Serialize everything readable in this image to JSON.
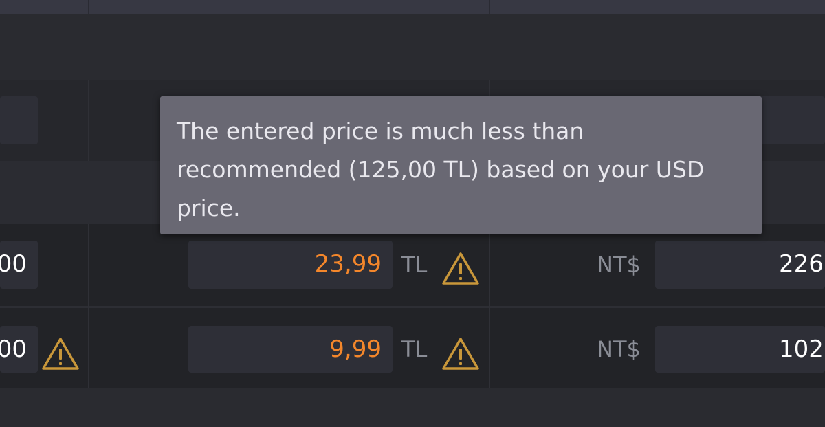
{
  "tooltip": {
    "text": "The entered price is much less than recommended (125,00 TL) based on your USD price."
  },
  "rows": [
    {
      "left_value_partial": "00",
      "tl_price": "23,99",
      "tl_currency": "TL",
      "twd_currency": "NT$",
      "twd_value_partial": "226"
    },
    {
      "left_value_partial": "00",
      "tl_price": "9,99",
      "tl_currency": "TL",
      "twd_currency": "NT$",
      "twd_value_partial": "102"
    }
  ],
  "colors": {
    "warning_text": "#f4872b",
    "warning_icon": "#c9973a",
    "tooltip_bg": "#696873",
    "field_bg": "#2e2f37"
  },
  "icons": [
    "warning-triangle-icon"
  ]
}
